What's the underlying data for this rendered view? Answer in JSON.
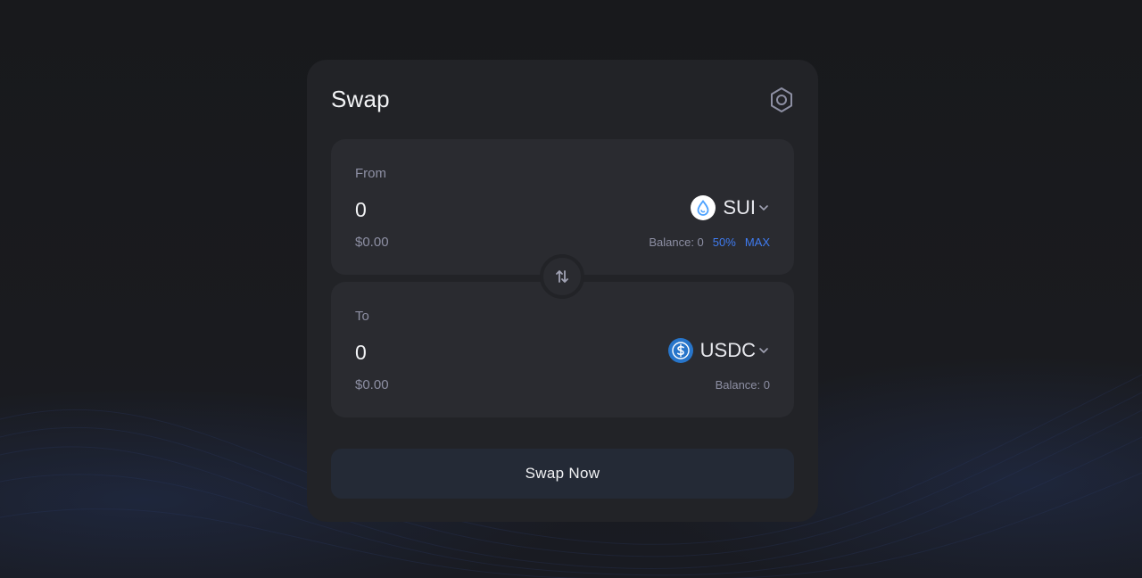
{
  "swap": {
    "title": "Swap",
    "settings_icon": "gear-hexagon-icon",
    "from": {
      "label": "From",
      "amount": "0",
      "usd_value": "$0.00",
      "token_symbol": "SUI",
      "token_icon": "sui-droplet-icon",
      "balance_text": "Balance: 0",
      "pct_50_label": "50%",
      "max_label": "MAX"
    },
    "toggle_icon": "swap-arrows-icon",
    "to": {
      "label": "To",
      "amount": "0",
      "usd_value": "$0.00",
      "token_symbol": "USDC",
      "token_icon": "usdc-dollar-icon",
      "balance_text": "Balance: 0"
    },
    "submit_label": "Swap Now"
  },
  "colors": {
    "background": "#1a1b1f",
    "card": "#222327",
    "panel": "#2a2b30",
    "accent_link": "#3f7bf0",
    "button": "#242a36",
    "sui_blue": "#4da2ff",
    "usdc_blue": "#2775ca"
  }
}
